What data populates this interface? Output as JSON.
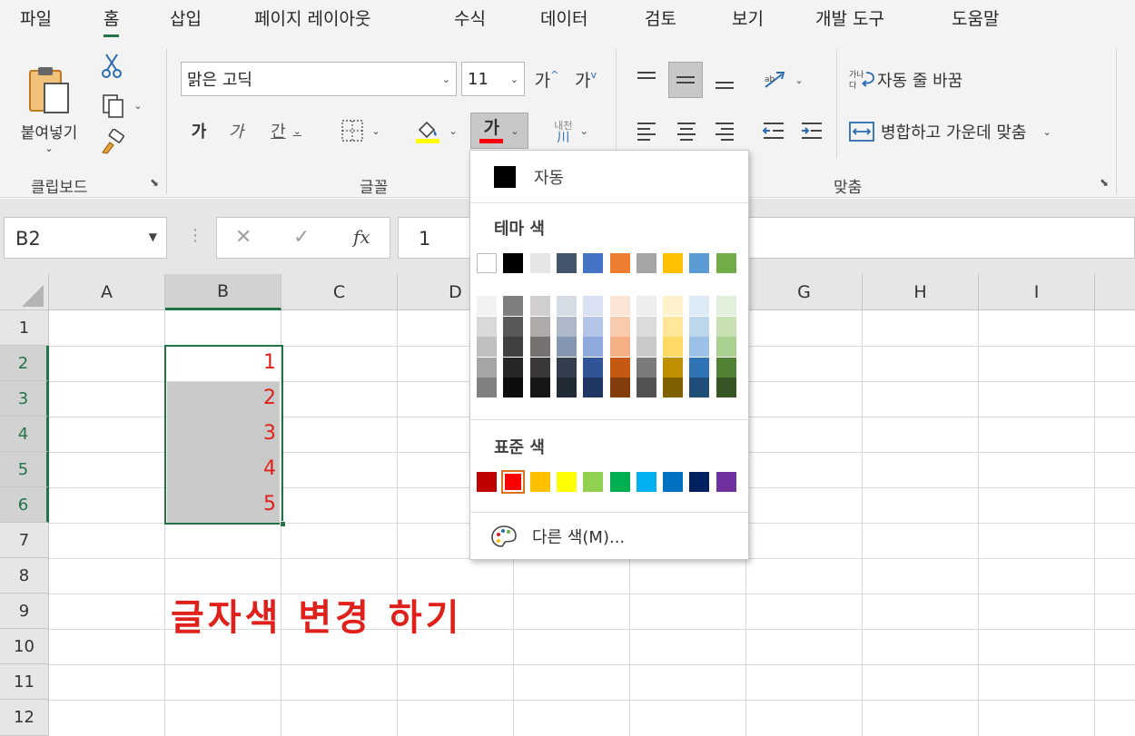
{
  "menu": {
    "tabs": [
      "파일",
      "홈",
      "삽입",
      "페이지 레이아웃",
      "수식",
      "데이터",
      "검토",
      "보기",
      "개발 도구",
      "도움말"
    ],
    "active_index": 1
  },
  "clipboard": {
    "paste_label": "붙여넣기",
    "group_label": "클립보드"
  },
  "font": {
    "font_name": "맑은 고딕",
    "font_size": "11",
    "grow_glyph": "가",
    "shrink_glyph": "가",
    "bold_glyph": "가",
    "italic_glyph": "가",
    "underline_glyph": "간",
    "fontcolor_glyph": "가",
    "phonetic_glyph": "내천",
    "group_label": "글꼴"
  },
  "alignment": {
    "wrap_text_label": "자동 줄 바꿈",
    "merge_center_label": "병합하고 가운데 맞춤",
    "group_label": "맞춤"
  },
  "formula_bar": {
    "name_box": "B2",
    "formula_value": "1",
    "fx_label": "fx"
  },
  "grid": {
    "columns": [
      "A",
      "B",
      "C",
      "D",
      "E",
      "F",
      "G",
      "H",
      "I"
    ],
    "rows": [
      "1",
      "2",
      "3",
      "4",
      "5",
      "6",
      "7",
      "8",
      "9",
      "10",
      "11",
      "12"
    ],
    "selected_column": "B",
    "selected_rows": [
      "2",
      "3",
      "4",
      "5",
      "6"
    ],
    "b_values": [
      "1",
      "2",
      "3",
      "4",
      "5"
    ],
    "annotation": "글자색 변경 하기"
  },
  "font_color_dropdown": {
    "auto_label": "자동",
    "theme_header": "테마 색",
    "standard_header": "표준 색",
    "more_colors_label": "다른 색(M)...",
    "theme_base": [
      "#ffffff",
      "#000000",
      "#e7e6e6",
      "#44546a",
      "#4472c4",
      "#ed7d31",
      "#a5a5a5",
      "#ffc000",
      "#5b9bd5",
      "#70ad47"
    ],
    "theme_tints": [
      [
        "#f2f2f2",
        "#d9d9d9",
        "#bfbfbf",
        "#a6a6a6",
        "#808080"
      ],
      [
        "#7f7f7f",
        "#595959",
        "#404040",
        "#262626",
        "#0d0d0d"
      ],
      [
        "#d0cece",
        "#aeaaaa",
        "#757171",
        "#3a3838",
        "#171616"
      ],
      [
        "#d6dce4",
        "#adb9ca",
        "#8496b0",
        "#333f4f",
        "#222a35"
      ],
      [
        "#d9e1f2",
        "#b4c6e7",
        "#8ea9db",
        "#305496",
        "#203764"
      ],
      [
        "#fce4d6",
        "#f8cbad",
        "#f4b084",
        "#c65911",
        "#833c0c"
      ],
      [
        "#ededed",
        "#dbdbdb",
        "#c9c9c9",
        "#7b7b7b",
        "#525252"
      ],
      [
        "#fff2cc",
        "#ffe699",
        "#ffd966",
        "#bf8f00",
        "#806000"
      ],
      [
        "#ddebf7",
        "#bdd7ee",
        "#9bc2e6",
        "#2f75b5",
        "#1f4e78"
      ],
      [
        "#e2efda",
        "#c6e0b4",
        "#a9d08e",
        "#548235",
        "#375623"
      ]
    ],
    "standard_colors": [
      "#c00000",
      "#ff0000",
      "#ffc000",
      "#ffff00",
      "#92d050",
      "#00b050",
      "#00b0f0",
      "#0070c0",
      "#002060",
      "#7030a0"
    ],
    "selected_standard_index": 1
  },
  "colors": {
    "accent_green": "#217346",
    "font_red": "#e0211b",
    "highlight_yellow": "#ffff00"
  }
}
